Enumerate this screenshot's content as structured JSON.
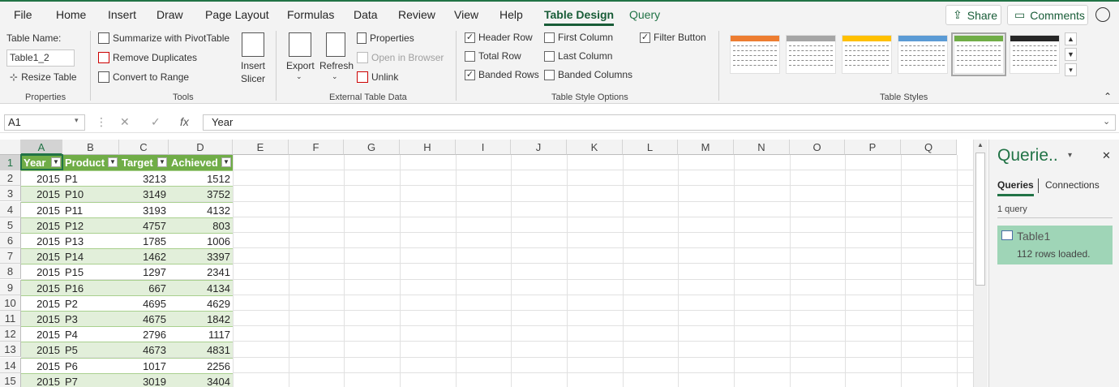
{
  "menu": {
    "tabs": [
      "File",
      "Home",
      "Insert",
      "Draw",
      "Page Layout",
      "Formulas",
      "Data",
      "Review",
      "View",
      "Help",
      "Table Design",
      "Query"
    ],
    "share_label": "Share",
    "comments_label": "Comments"
  },
  "ribbon": {
    "properties": {
      "table_name_label": "Table Name:",
      "table_name_value": "Table1_2",
      "resize_label": "Resize Table",
      "group_label": "Properties"
    },
    "tools": {
      "summarize": "Summarize with PivotTable",
      "remove_dup": "Remove Duplicates",
      "convert": "Convert to Range",
      "insert_slicer_1": "Insert",
      "insert_slicer_2": "Slicer",
      "group_label": "Tools"
    },
    "external": {
      "export": "Export",
      "refresh": "Refresh",
      "properties": "Properties",
      "open_browser": "Open in Browser",
      "unlink": "Unlink",
      "group_label": "External Table Data"
    },
    "style_options": {
      "header_row": "Header Row",
      "total_row": "Total Row",
      "banded_rows": "Banded Rows",
      "first_column": "First Column",
      "last_column": "Last Column",
      "banded_columns": "Banded Columns",
      "filter_button": "Filter Button",
      "group_label": "Table Style Options",
      "checked": {
        "header_row": true,
        "total_row": false,
        "banded_rows": true,
        "first_column": false,
        "last_column": false,
        "banded_columns": false,
        "filter_button": true
      }
    },
    "styles": {
      "group_label": "Table Styles",
      "swatch_colors": [
        "#ed7d31",
        "#a5a5a5",
        "#ffc000",
        "#5b9bd5",
        "#70ad47",
        "#262626"
      ]
    }
  },
  "formula_bar": {
    "cell_ref": "A1",
    "fx": "fx",
    "value": "Year"
  },
  "sheet": {
    "columns": [
      "A",
      "B",
      "C",
      "D",
      "E",
      "F",
      "G",
      "H",
      "I",
      "J",
      "K",
      "L",
      "M",
      "N",
      "O",
      "P",
      "Q"
    ],
    "rows": [
      "1",
      "2",
      "3",
      "4",
      "5",
      "6",
      "7",
      "8",
      "9",
      "10",
      "11",
      "12",
      "13",
      "14",
      "15"
    ],
    "headers": [
      "Year",
      "Product",
      "Target",
      "Achieved"
    ],
    "data": [
      [
        "2015",
        "P1",
        "3213",
        "1512"
      ],
      [
        "2015",
        "P10",
        "3149",
        "3752"
      ],
      [
        "2015",
        "P11",
        "3193",
        "4132"
      ],
      [
        "2015",
        "P12",
        "4757",
        "803"
      ],
      [
        "2015",
        "P13",
        "1785",
        "1006"
      ],
      [
        "2015",
        "P14",
        "1462",
        "3397"
      ],
      [
        "2015",
        "P15",
        "1297",
        "2341"
      ],
      [
        "2015",
        "P16",
        "667",
        "4134"
      ],
      [
        "2015",
        "P2",
        "4695",
        "4629"
      ],
      [
        "2015",
        "P3",
        "4675",
        "1842"
      ],
      [
        "2015",
        "P4",
        "2796",
        "1117"
      ],
      [
        "2015",
        "P5",
        "4673",
        "4831"
      ],
      [
        "2015",
        "P6",
        "1017",
        "2256"
      ],
      [
        "2015",
        "P7",
        "3019",
        "3404"
      ]
    ]
  },
  "queries_pane": {
    "title": "Querie..",
    "tab_queries": "Queries",
    "tab_connections": "Connections",
    "count": "1 query",
    "item_name": "Table1",
    "item_status": "112 rows loaded."
  }
}
